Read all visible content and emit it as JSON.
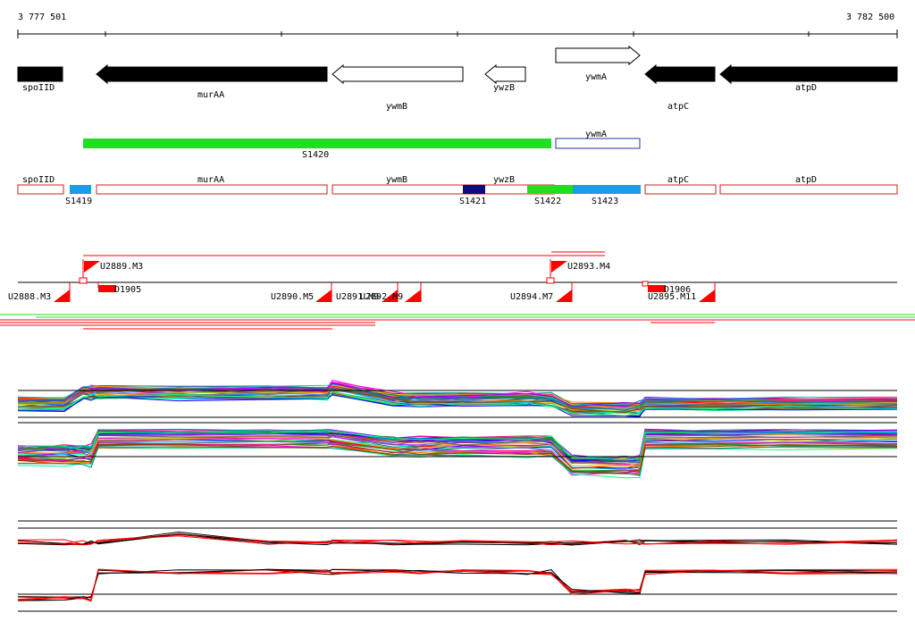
{
  "coords": {
    "start": "3 777 501",
    "end": "3 782 500"
  },
  "genes_row": [
    {
      "label": "spoIID",
      "fill": "#000000",
      "dir": "left"
    },
    {
      "label": "murAA",
      "fill": "#000000",
      "dir": "left"
    },
    {
      "label": "ywmB",
      "fill": "#ffffff",
      "dir": "left"
    },
    {
      "label": "ywzB",
      "fill": "#ffffff",
      "dir": "left"
    },
    {
      "label": "ywmA",
      "fill": "#ffffff",
      "dir": "right"
    },
    {
      "label": "atpC",
      "fill": "#000000",
      "dir": "left"
    },
    {
      "label": "atpD",
      "fill": "#000000",
      "dir": "left"
    }
  ],
  "segments_row": [
    {
      "label": "S1420",
      "color": "#22dd22"
    },
    {
      "label": "ywmA",
      "color": "#2233aa"
    }
  ],
  "annot_row": {
    "boxes": [
      {
        "label": "spoIID"
      },
      {
        "label": "murAA"
      },
      {
        "label": "ywmB"
      },
      {
        "label": "ywzB"
      },
      {
        "label": "atpC"
      },
      {
        "label": "atpD"
      }
    ],
    "segments": [
      {
        "label": "S1419",
        "color": "#1e9be6"
      },
      {
        "label": "S1421",
        "color": "#0c0c7a"
      },
      {
        "label": "S1422",
        "color": "#22dd22"
      },
      {
        "label": "S1423",
        "color": "#1e9be6"
      }
    ],
    "box_color": "#cc2222"
  },
  "upstream_features": [
    {
      "label": "U2888.M3"
    },
    {
      "label": "U2889.M3"
    },
    {
      "label": "D1905"
    },
    {
      "label": "U2890.M5"
    },
    {
      "label": "U2891.M9"
    },
    {
      "label": "U2892.M9"
    },
    {
      "label": "U2893.M4"
    },
    {
      "label": "U2894.M7"
    },
    {
      "label": "D1906"
    },
    {
      "label": "U2895.M11"
    }
  ],
  "colors": {
    "accent_red": "#ff0000",
    "green": "#22dd22",
    "blue": "#1e9be6"
  }
}
